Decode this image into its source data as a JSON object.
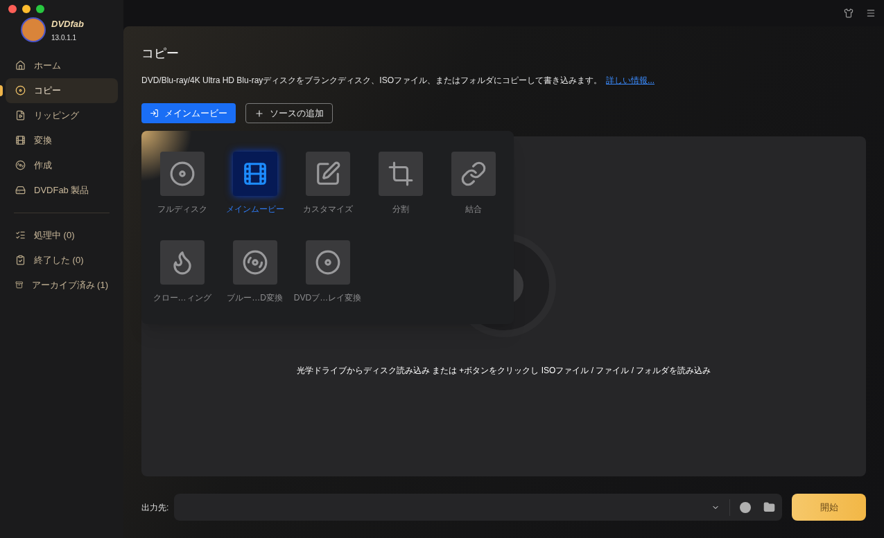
{
  "app": {
    "name": "DVDfab",
    "version": "13.0.1.1"
  },
  "sidebar": {
    "items": [
      {
        "label": "ホーム",
        "selected": false
      },
      {
        "label": "コピー",
        "selected": true
      },
      {
        "label": "リッピング",
        "selected": false
      },
      {
        "label": "変換",
        "selected": false
      },
      {
        "label": "作成",
        "selected": false
      },
      {
        "label": "DVDFab 製品",
        "selected": false
      }
    ],
    "queue_items": [
      {
        "label": "処理中 (0)",
        "selected": false
      },
      {
        "label": "終了した (0)",
        "selected": false
      },
      {
        "label": "アーカイブ済み (1)",
        "selected": false
      }
    ]
  },
  "header": {
    "title": "コピー",
    "description": "DVD/Blu-ray/4K Ultra HD Blu-rayディスクをブランクディスク、ISOファイル、またはフォルダにコピーして書き込みます。",
    "link": "詳しい情報..."
  },
  "toolbar": {
    "mode_button": "メインムービー",
    "add_source_button": "ソースの追加"
  },
  "modes": [
    {
      "label": "フルディスク",
      "selected": false
    },
    {
      "label": "メインムービー",
      "selected": true
    },
    {
      "label": "カスタマイズ",
      "selected": false
    },
    {
      "label": "分割",
      "selected": false
    },
    {
      "label": "結合",
      "selected": false
    },
    {
      "label": "クロー…ィング",
      "selected": false
    },
    {
      "label": "ブルー…D変換",
      "selected": false
    },
    {
      "label": "DVDブ…レイ変換",
      "selected": false
    }
  ],
  "drop_zone": {
    "hint": "光学ドライブからディスク読み込み または +ボタンをクリックし ISOファイル / ファイル / フォルダを読み込み"
  },
  "output": {
    "label": "出力先:",
    "start_button": "開始"
  }
}
